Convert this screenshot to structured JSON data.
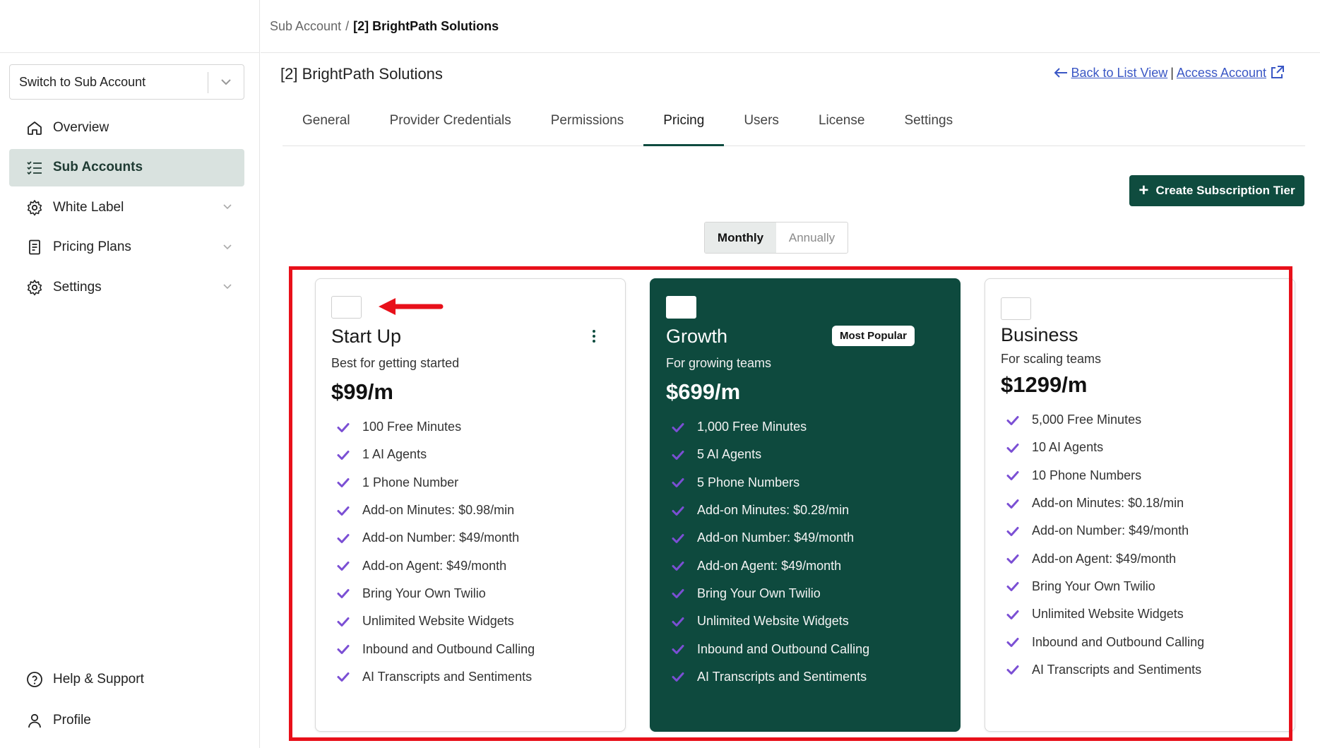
{
  "breadcrumb": {
    "parent": "Sub Account",
    "separator": "/",
    "current": "[2] BrightPath Solutions"
  },
  "sidebar": {
    "switch_placeholder": "Switch to Sub Account",
    "items": [
      {
        "label": "Overview",
        "icon": "home-icon",
        "active": false,
        "expandable": false
      },
      {
        "label": "Sub Accounts",
        "icon": "list-check-icon",
        "active": true,
        "expandable": false
      },
      {
        "label": "White Label",
        "icon": "gear-badge-icon",
        "active": false,
        "expandable": true
      },
      {
        "label": "Pricing Plans",
        "icon": "receipt-icon",
        "active": false,
        "expandable": true
      },
      {
        "label": "Settings",
        "icon": "gear-icon",
        "active": false,
        "expandable": true
      }
    ],
    "bottom_items": [
      {
        "label": "Help & Support",
        "icon": "help-circle-icon"
      },
      {
        "label": "Profile",
        "icon": "user-icon"
      }
    ]
  },
  "page": {
    "title": "[2] BrightPath Solutions",
    "back_link": "Back to List View",
    "divider": "|",
    "access_link": "Access Account"
  },
  "tabs": [
    {
      "label": "General",
      "active": false
    },
    {
      "label": "Provider Credentials",
      "active": false
    },
    {
      "label": "Permissions",
      "active": false
    },
    {
      "label": "Pricing",
      "active": true
    },
    {
      "label": "Users",
      "active": false
    },
    {
      "label": "License",
      "active": false
    },
    {
      "label": "Settings",
      "active": false
    }
  ],
  "create_button": {
    "label": "Create Subscription Tier"
  },
  "billing_toggle": {
    "options": [
      "Monthly",
      "Annually"
    ],
    "selected": "Monthly"
  },
  "plans": [
    {
      "name": "Start Up",
      "tagline": "Best for getting started",
      "price": "$99/m",
      "featured": false,
      "badge": "",
      "has_menu": true,
      "features": [
        "100 Free Minutes",
        "1 AI Agents",
        "1 Phone Number",
        "Add-on Minutes: $0.98/min",
        "Add-on Number: $49/month",
        "Add-on Agent: $49/month",
        "Bring Your Own Twilio",
        "Unlimited Website Widgets",
        "Inbound and Outbound Calling",
        "AI Transcripts and Sentiments"
      ]
    },
    {
      "name": "Growth",
      "tagline": "For growing teams",
      "price": "$699/m",
      "featured": true,
      "badge": "Most Popular",
      "has_menu": false,
      "features": [
        "1,000 Free Minutes",
        "5 AI Agents",
        "5 Phone Numbers",
        "Add-on Minutes: $0.28/min",
        "Add-on Number: $49/month",
        "Add-on Agent: $49/month",
        "Bring Your Own Twilio",
        "Unlimited Website Widgets",
        "Inbound and Outbound Calling",
        "AI Transcripts and Sentiments"
      ]
    },
    {
      "name": "Business",
      "tagline": "For scaling teams",
      "price": "$1299/m",
      "featured": false,
      "badge": "",
      "has_menu": false,
      "features": [
        "5,000 Free Minutes",
        "10 AI Agents",
        "10 Phone Numbers",
        "Add-on Minutes: $0.18/min",
        "Add-on Number: $49/month",
        "Add-on Agent: $49/month",
        "Bring Your Own Twilio",
        "Unlimited Website Widgets",
        "Inbound and Outbound Calling",
        "AI Transcripts and Sentiments"
      ]
    }
  ],
  "colors": {
    "brand": "#0f4c3f",
    "check": "#7b4fd4",
    "link": "#3a57c5",
    "annotation": "#e8101a",
    "sidebar_active": "#d9e2df"
  }
}
